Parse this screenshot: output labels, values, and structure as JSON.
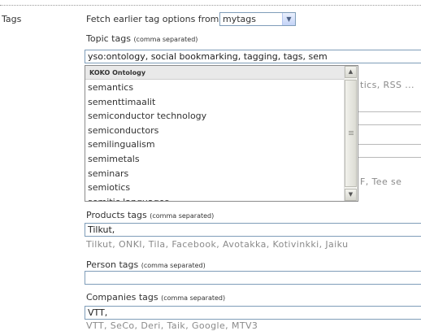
{
  "row": {
    "label": "Tags"
  },
  "fetch": {
    "label": "Fetch earlier tag options from",
    "selected": "mytags"
  },
  "topic": {
    "label": "Topic tags",
    "note": "(comma separated)",
    "value": "yso:ontology, social bookmarking, tagging, tags, sem"
  },
  "dropdown": {
    "header": "KOKO Ontology",
    "items": [
      "semantics",
      "sementtimaalit",
      "semiconductor technology",
      "semiconductors",
      "semilingualism",
      "semimetals",
      "seminars",
      "semiotics",
      "semitic languages"
    ]
  },
  "hidden_suggestions": {
    "line1": "tics, RSS ...",
    "line2": "F, Tee se"
  },
  "products": {
    "label": "Products tags",
    "note": "(comma separated)",
    "value": "Tilkut,",
    "suggestions": "Tilkut, ONKI, Tila, Facebook, Avotakka, Kotivinkki, Jaiku"
  },
  "person": {
    "label": "Person tags",
    "note": "(comma separated)",
    "value": ""
  },
  "companies": {
    "label": "Companies tags",
    "note": "(comma separated)",
    "value": "VTT,",
    "suggestions": "VTT, SeCo, Deri, Taik, Google, MTV3"
  }
}
